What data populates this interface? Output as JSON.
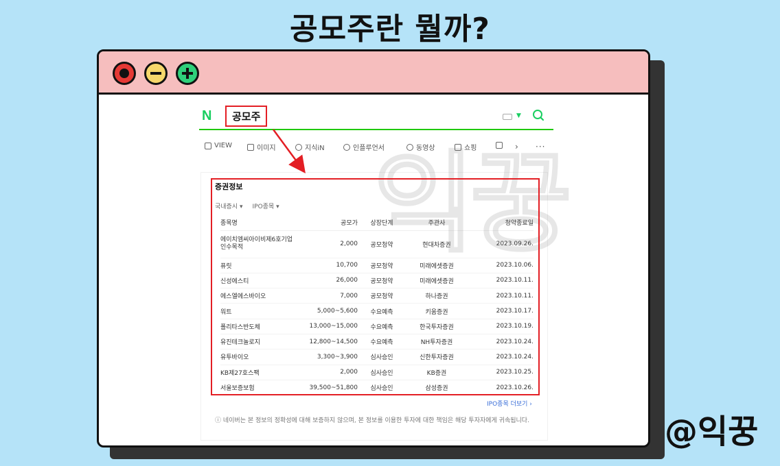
{
  "headline": "공모주란 뭘까?",
  "brand_handle": "@익꿍",
  "watermark": "익꿍",
  "search": {
    "logo": "N",
    "query": "공모주"
  },
  "tabs": [
    "VIEW",
    "이미지",
    "지식iN",
    "인플루언서",
    "동영상",
    "쇼핑"
  ],
  "section": {
    "title": "증권정보",
    "filter_market": "국내증시 ▾",
    "filter_ipo": "IPO종목 ▾",
    "more_link": "IPO종목 더보기 ›",
    "notice": "ⓘ 네이버는 본 정보의 정확성에 대해 보증하지 않으며, 본 정보를 이용한 투자에 대한 책임은 해당 투자자에게 귀속됩니다."
  },
  "table": {
    "headers": [
      "종목명",
      "공모가",
      "상장단계",
      "주관사",
      "청약종료일"
    ],
    "rows": [
      [
        "에이치엠씨아이비제6호기업인수목적",
        "2,000",
        "공모청약",
        "현대차증권",
        "2023.09.26."
      ],
      [
        "퓨릿",
        "10,700",
        "공모청약",
        "미래에셋증권",
        "2023.10.06."
      ],
      [
        "신성에스티",
        "26,000",
        "공모청약",
        "미래에셋증권",
        "2023.10.11."
      ],
      [
        "에스엘에스바이오",
        "7,000",
        "공모청약",
        "하나증권",
        "2023.10.11."
      ],
      [
        "워트",
        "5,000~5,600",
        "수요예측",
        "키움증권",
        "2023.10.17."
      ],
      [
        "폴리타스반도체",
        "13,000~15,000",
        "수요예측",
        "한국투자증권",
        "2023.10.19."
      ],
      [
        "유진테크놀로지",
        "12,800~14,500",
        "수요예측",
        "NH투자증권",
        "2023.10.24."
      ],
      [
        "유투바이오",
        "3,300~3,900",
        "심사승인",
        "신한투자증권",
        "2023.10.24."
      ],
      [
        "KB제27호스팩",
        "2,000",
        "심사승인",
        "KB증권",
        "2023.10.25."
      ],
      [
        "서울보증보험",
        "39,500~51,800",
        "심사승인",
        "삼성증권",
        "2023.10.26."
      ]
    ]
  },
  "colors": {
    "background": "#b5e3f8",
    "titlebar": "#f6bebe",
    "highlight": "#e31e24",
    "naver_green": "#19ce60"
  }
}
